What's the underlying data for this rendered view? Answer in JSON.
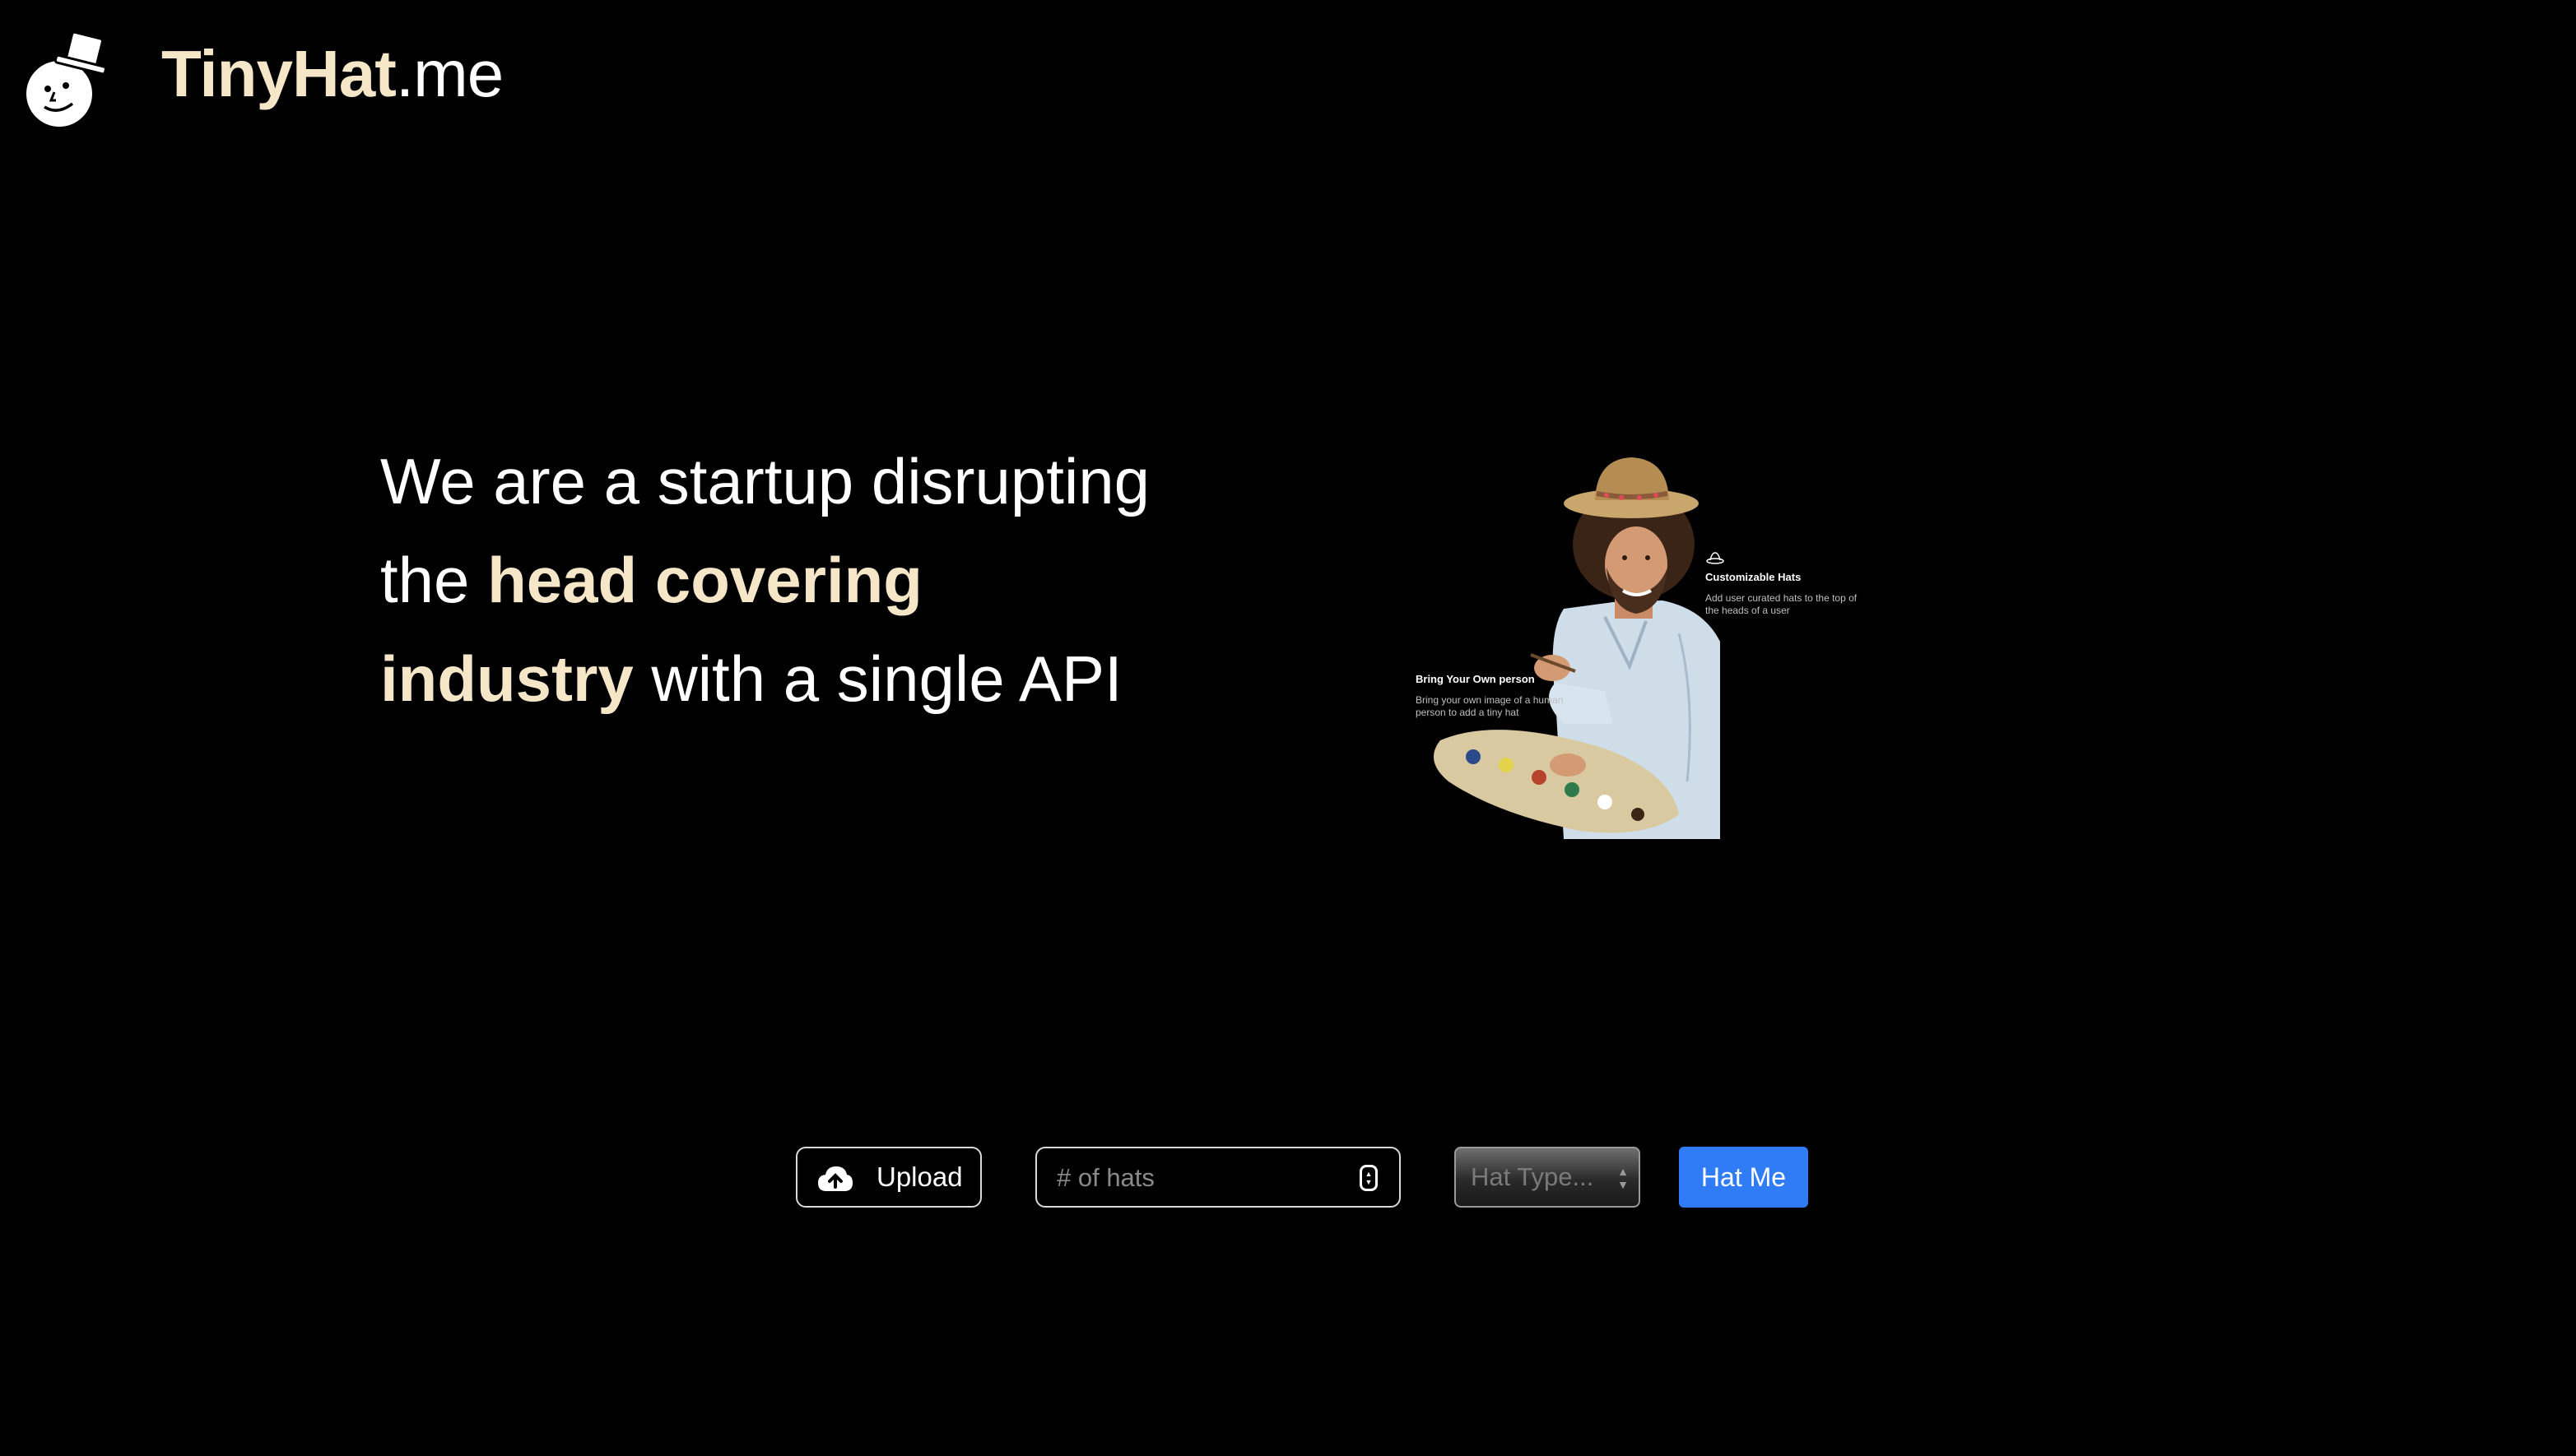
{
  "header": {
    "brand_name": "TinyHat",
    "brand_tld": ".me",
    "logo_icon": "snowman-top-hat-icon"
  },
  "hero": {
    "text_1": "We are a startup disrupting the ",
    "highlight": "head covering industry",
    "text_2": " with a single API"
  },
  "illustration": {
    "image_icon": "painter-with-hat-illustration",
    "feature_1": {
      "icon": "hat-icon",
      "title": "Customizable Hats",
      "description": "Add user curated hats to the top of the heads of a user"
    },
    "feature_2": {
      "title": "Bring Your Own person",
      "description": "Bring your own image of a human person to add a tiny hat"
    }
  },
  "controls": {
    "upload_label": "Upload",
    "upload_icon": "cloud-upload-icon",
    "hats_placeholder": "# of hats",
    "hat_type_label": "Hat Type...",
    "submit_label": "Hat Me"
  },
  "colors": {
    "background": "#000000",
    "accent": "#f5e6c8",
    "primary_button": "#2f7cf6"
  }
}
